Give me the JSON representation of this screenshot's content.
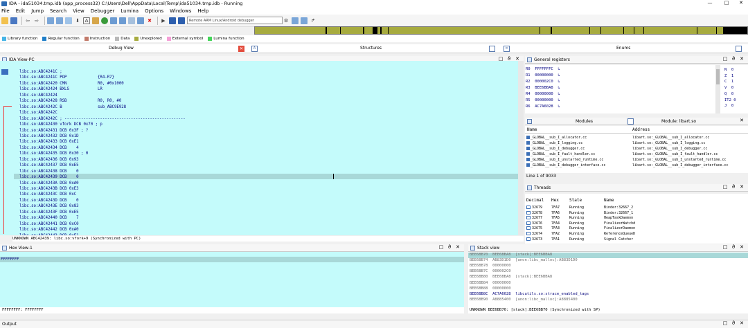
{
  "window": {
    "title": "IDA - ida51034.tmp.idb (app_process32) C:\\Users\\Dell\\AppData\\Local\\Temp\\ida51034.tmp.idb - Running",
    "minimize": "—",
    "maximize": "□",
    "close": "✕"
  },
  "menu": [
    "File",
    "Edit",
    "Jump",
    "Search",
    "View",
    "Debugger",
    "Lumina",
    "Options",
    "Windows",
    "Help"
  ],
  "toolbar": {
    "debugger_select": "Remote ARM Linux/Android debugger"
  },
  "legend": [
    {
      "label": "Library function",
      "color": "#46b4e6"
    },
    {
      "label": "Regular function",
      "color": "#1e7ec8"
    },
    {
      "label": "Instruction",
      "color": "#c27a6a"
    },
    {
      "label": "Data",
      "color": "#b8b8b8"
    },
    {
      "label": "Unexplored",
      "color": "#a7ab3f"
    },
    {
      "label": "External symbol",
      "color": "#f59fd6"
    },
    {
      "label": "Lumina function",
      "color": "#45d45a"
    }
  ],
  "tabs": {
    "debug_view": "Debug View",
    "structures": "Structures",
    "enums": "Enums"
  },
  "ida_view": {
    "title": "IDA View-PC",
    "lines": [
      "libc.so:ABC4241C ;",
      "libc.so:ABC4241C POP             {R4-R7}",
      "libc.so:ABC42420 CMN             R0, #0x1000",
      "libc.so:ABC42424 BXLS            LR",
      "libc.so:ABC42424",
      "libc.so:ABC42428 RSB             R0, R0, #0",
      "libc.so:ABC4242C B               sub_ABC9E928",
      "libc.so:ABC4242C",
      "libc.so:ABC4242C ; ---------------------------------------------------",
      "libc.so:ABC42430 vfork DCB 0x70 ; p",
      "libc.so:ABC42431 DCB 0x3F ; ?",
      "libc.so:ABC42432 DCB 0x1D",
      "libc.so:ABC42433 DCB 0xE1",
      "libc.so:ABC42434 DCB    4",
      "libc.so:ABC42435 DCB 0x30 ; 0",
      "libc.so:ABC42436 DCB 0x93",
      "libc.so:ABC42437 DCB 0xE5",
      "libc.so:ABC42438 DCB    0",
      "libc.so:ABC42439 DCB    0",
      "libc.so:ABC4243A DCB 0xA0",
      "libc.so:ABC4243B DCB 0xE3",
      "libc.so:ABC4243C DCB 0xC",
      "libc.so:ABC4243D DCB    0",
      "libc.so:ABC4243E DCB 0x83",
      "libc.so:ABC4243F DCB 0xE5",
      "libc.so:ABC42440 DCB    7",
      "libc.so:ABC42441 DCB 0xC0",
      "libc.so:ABC42442 DCB 0xA0",
      "libc.so:ABC42443 DCB 0xE1"
    ],
    "status": "UNKNOWN ABC42439: libc.so:vfork+9 (Synchronized with PC)"
  },
  "hex_view": {
    "title": "Hex View-1",
    "first_line": "FFFFFFFF",
    "status": "FFFFFFFF: FFFFFFFF"
  },
  "stack_view": {
    "title": "Stack view",
    "lines": [
      "BEE6BB70  BEE6BBA8  [stack]:BEE6BBA8",
      "BEE6BB74  AB83D1D0  [anon:libc_malloc]:AB83D1D0",
      "BEE6BB78  00000000",
      "BEE6BB7C  000002C0",
      "BEE6BB80  BEE6BBA8  [stack]:BEE6BBA8",
      "BEE6BB84  00000000",
      "BEE6BB88  00000000",
      "BEE6BB8C  AC7A6028  libcutils.so:strace_enabled_tags",
      "BEE6BB90  A8885400  [anon:libc_malloc]:A8885400"
    ],
    "status": "UNKNOWN BEE6BB70: [stack]:BEE6BB70 (Synchronized with SP)"
  },
  "registers": {
    "title": "General registers",
    "rows": [
      "R0  FFFFFFFC  ↳",
      "R1  00000000  ↳",
      "R2  000002C0  ↳",
      "R3  BEE6BBA8  ↳",
      "R4  00000000  ↳",
      "R5  00000000  ↳",
      "R6  AC7A6028  ↳"
    ],
    "flags": [
      "N  0",
      "Z  1",
      "C  1",
      "V  0",
      "Q  0",
      "IT2 0",
      "J  0"
    ]
  },
  "modules": {
    "tab_modules": "Modules",
    "tab_module_libart": "Module: libart.so",
    "col_name": "Name",
    "col_address": "Address",
    "rows": [
      {
        "name": "_GLOBAL__sub_I_allocator.cc",
        "address": "libart.so:_GLOBAL__sub_I_allocator.cc"
      },
      {
        "name": "_GLOBAL__sub_I_logging.cc",
        "address": "libart.so:_GLOBAL__sub_I_logging.cc"
      },
      {
        "name": "_GLOBAL__sub_I_debugger.cc",
        "address": "libart.so:_GLOBAL__sub_I_debugger.cc"
      },
      {
        "name": "_GLOBAL__sub_I_fault_handler.cc",
        "address": "libart.so:_GLOBAL__sub_I_fault_handler.cc"
      },
      {
        "name": "_GLOBAL__sub_I_unstarted_runtime.cc",
        "address": "libart.so:_GLOBAL__sub_I_unstarted_runtime.cc"
      },
      {
        "name": "_GLOBAL__sub_I_debugger_interface.cc",
        "address": "libart.so:_GLOBAL__sub_I_debugger_interface.cc"
      }
    ],
    "status": "Line 1 of 9033"
  },
  "threads": {
    "title": "Threads",
    "cols": [
      "Decimal",
      "Hex",
      "State",
      "Name"
    ],
    "rows": [
      [
        "32679",
        "7FA7",
        "Running",
        "Binder:32667_2"
      ],
      [
        "32678",
        "7FA6",
        "Running",
        "Binder:32667_1"
      ],
      [
        "32677",
        "7FA5",
        "Running",
        "HeapTaskDaemon"
      ],
      [
        "32676",
        "7FA4",
        "Running",
        "FinalizerWatchd"
      ],
      [
        "32675",
        "7FA3",
        "Running",
        "FinalizerDaemon"
      ],
      [
        "32674",
        "7FA2",
        "Running",
        "ReferenceQueueD"
      ],
      [
        "32673",
        "7FA1",
        "Running",
        "Signal Catcher"
      ]
    ]
  },
  "output": {
    "title": "Output"
  }
}
